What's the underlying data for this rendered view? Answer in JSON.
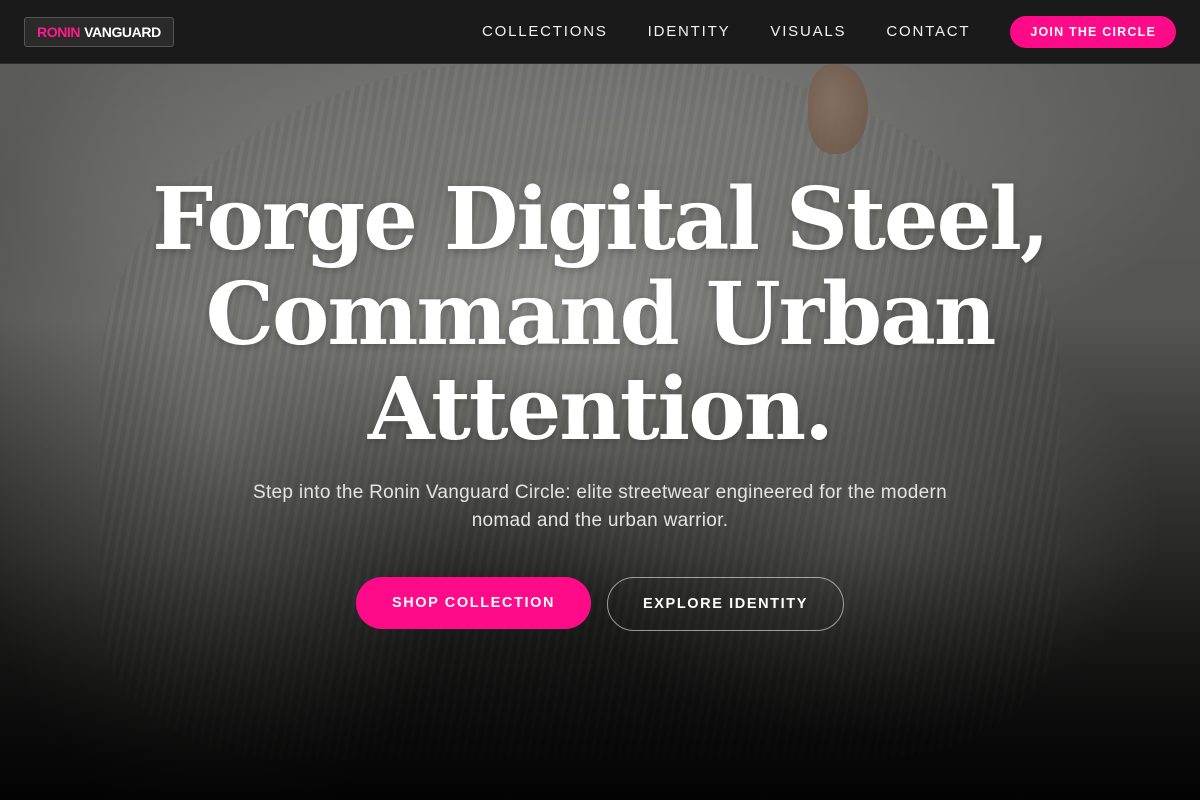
{
  "brand": {
    "name_part1": "RONIN",
    "name_part2": "VANGUARD",
    "accent_color": "#ff0a89"
  },
  "nav": {
    "links": [
      {
        "label": "COLLECTIONS"
      },
      {
        "label": "IDENTITY"
      },
      {
        "label": "VISUALS"
      },
      {
        "label": "CONTACT"
      }
    ],
    "cta_label": "JOIN THE CIRCLE"
  },
  "hero": {
    "headline_lines": [
      "Forge Digital Steel,",
      "Command Urban",
      "Attention."
    ],
    "subtext": "Step into the Ronin Vanguard Circle: elite streetwear engineered for the modern nomad and the urban warrior.",
    "primary_button": "SHOP COLLECTION",
    "secondary_button": "EXPLORE IDENTITY",
    "background_image": "knit sweater photo"
  }
}
